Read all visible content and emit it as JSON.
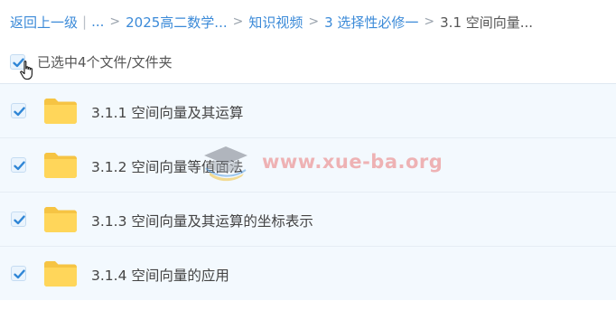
{
  "breadcrumb": {
    "back_label": "返回上一级",
    "ellipsis": "...",
    "items": [
      {
        "label": "2025高二数学..."
      },
      {
        "label": "知识视频"
      },
      {
        "label": "3 选择性必修一"
      },
      {
        "label": "3.1 空间向量..."
      }
    ]
  },
  "selection": {
    "label": "已选中4个文件/文件夹"
  },
  "files": [
    {
      "name": "3.1.1 空间向量及其运算",
      "checked": true
    },
    {
      "name": "3.1.2 空间向量等值面法",
      "checked": true
    },
    {
      "name": "3.1.3 空间向量及其运算的坐标表示",
      "checked": true
    },
    {
      "name": "3.1.4 空间向量的应用",
      "checked": true
    }
  ],
  "watermark": {
    "text": "www.xue-ba.org"
  },
  "colors": {
    "link": "#3b8ad8",
    "folder": "#ffd65a",
    "row_bg": "#f3f9fe",
    "check": "#2f86d6"
  }
}
